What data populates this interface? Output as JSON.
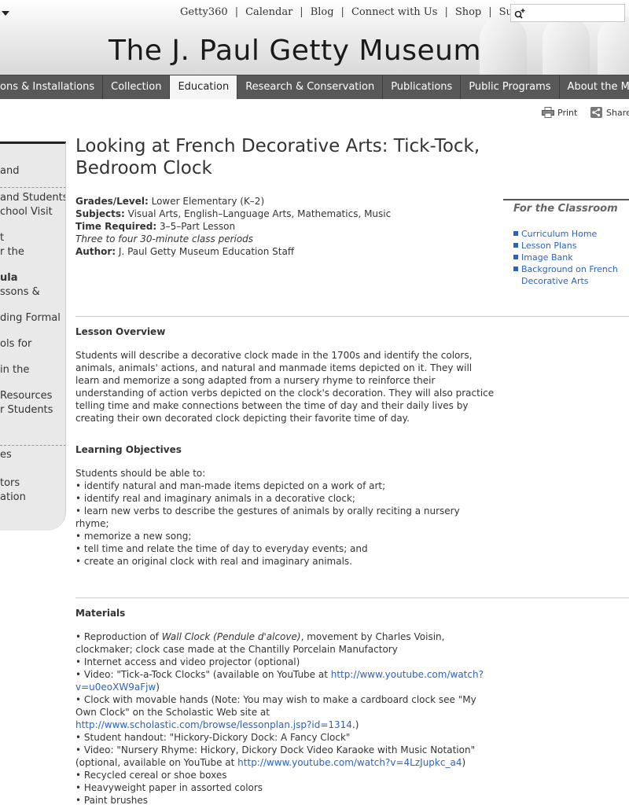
{
  "utility_nav": [
    "Getty360",
    "Calendar",
    "Blog",
    "Connect with Us",
    "Shop",
    "Support"
  ],
  "search": {
    "placeholder": ""
  },
  "site_title": "The J. Paul Getty Museum",
  "main_nav": [
    {
      "label": "Exhibitions & Installations",
      "shown": "ons & Installations"
    },
    {
      "label": "Collection"
    },
    {
      "label": "Education",
      "active": true
    },
    {
      "label": "Research & Conservation"
    },
    {
      "label": "Publications"
    },
    {
      "label": "Public Programs"
    },
    {
      "label": "About the Museum",
      "shown": "About the M"
    }
  ],
  "toolbar": {
    "print_label": "Print",
    "share_label": "Share"
  },
  "sidebar": [
    {
      "lines": [
        "and"
      ]
    },
    {
      "lines": [
        "and Students",
        "chool Visit"
      ]
    },
    {
      "lines": [
        "t",
        "r the"
      ]
    },
    {
      "lines": [
        "ula",
        "ssons &"
      ],
      "bold_first": true
    },
    {
      "lines": [
        "ding Formal"
      ]
    },
    {
      "lines": [
        "ols for"
      ]
    },
    {
      "lines": [
        "in the"
      ]
    },
    {
      "lines": [
        "Resources",
        "r Students"
      ]
    },
    {
      "lines": [
        "es"
      ]
    },
    {
      "lines": [
        "tors",
        "ation"
      ]
    }
  ],
  "page_title": "Looking at French Decorative Arts: Tick-Tock, Bedroom Clock",
  "meta": {
    "grades_label": "Grades/Level:",
    "grades": "Lower Elementary (K–2)",
    "subjects_label": "Subjects:",
    "subjects": "Visual Arts, English–Language Arts, Mathematics, Music",
    "time_label": "Time Required:",
    "time": "3–5–Part Lesson",
    "periods": "Three to four 30-minute class periods",
    "author_label": "Author:",
    "author": "J. Paul Getty Museum Education Staff"
  },
  "for_classroom": {
    "title": "For the Classroom",
    "links": [
      "Curriculum Home",
      "Lesson Plans",
      "Image Bank",
      "Background on French Decorative Arts"
    ]
  },
  "overview": {
    "heading": "Lesson Overview",
    "text": "Students will describe a decorative clock made in the 1700s and identify the colors, animals, animals' actions, and natural and manmade items depicted on it. They will learn and memorize a song adapted from a nursery rhyme to reinforce their understanding of action verbs depicted on the clock's decoration. They will also practice telling time and make connections between the time of day and their daily lives by creating their own decorated clock depicting their favorite time of day."
  },
  "objectives": {
    "heading": "Learning Objectives",
    "intro": "Students should be able to:",
    "items": [
      "• identify natural and man-made items depicted on a work of art;",
      "• identify real and imaginary animals in a decorative clock;",
      "• learn new verbs to describe the gestures of animals by orally reciting a nursery rhyme;",
      "• memorize a new song;",
      "• tell time and relate the time of day to everyday events; and",
      "• create an original clock with real and imaginary animals."
    ]
  },
  "materials": {
    "heading": "Materials",
    "m1_pre": "• Reproduction of ",
    "m1_italic": "Wall Clock (Pendule d'alcove)",
    "m1_post": ", movement by Charles Voisin, clockmaker; clock case made at the Chantilly Porcelain Manufactory",
    "m2": "• Internet access and video projector (optional)",
    "m3_pre": "• Video: \"Tick-a-Tock Clocks\" (available on YouTube at ",
    "m3_link": "http://www.youtube.com/watch?v=u0eoXW9aFjw",
    "m3_post": ")",
    "m4_pre": "• Clock with movable hands (Note: You may wish to make a cardboard clock see \"My Own Clock\" on the Scholastic Web site at ",
    "m4_link": "http://www.scholastic.com/browse/lessonplan.jsp?id=1314",
    "m4_post": ".)",
    "m5": "• Student handout: \"Hickory-Dickory Dock: A Fancy Clock\"",
    "m6_pre": "• Video: \"Nursery Rhyme: Hickory, Dickory Dock Video Karaoke with Music Notation\" (optional, available on YouTube at ",
    "m6_link": "http://www.youtube.com/watch?v=4LzJupkc_a4",
    "m6_post": ")",
    "m7": "• Recycled cereal or shoe boxes",
    "m8": "• Heavyweight paper in assorted colors",
    "m9": "• Paint brushes"
  },
  "colors": {
    "nav_bg": "#585858",
    "link": "#2b62c2",
    "sidebar_bg": "#e9e9e9"
  }
}
